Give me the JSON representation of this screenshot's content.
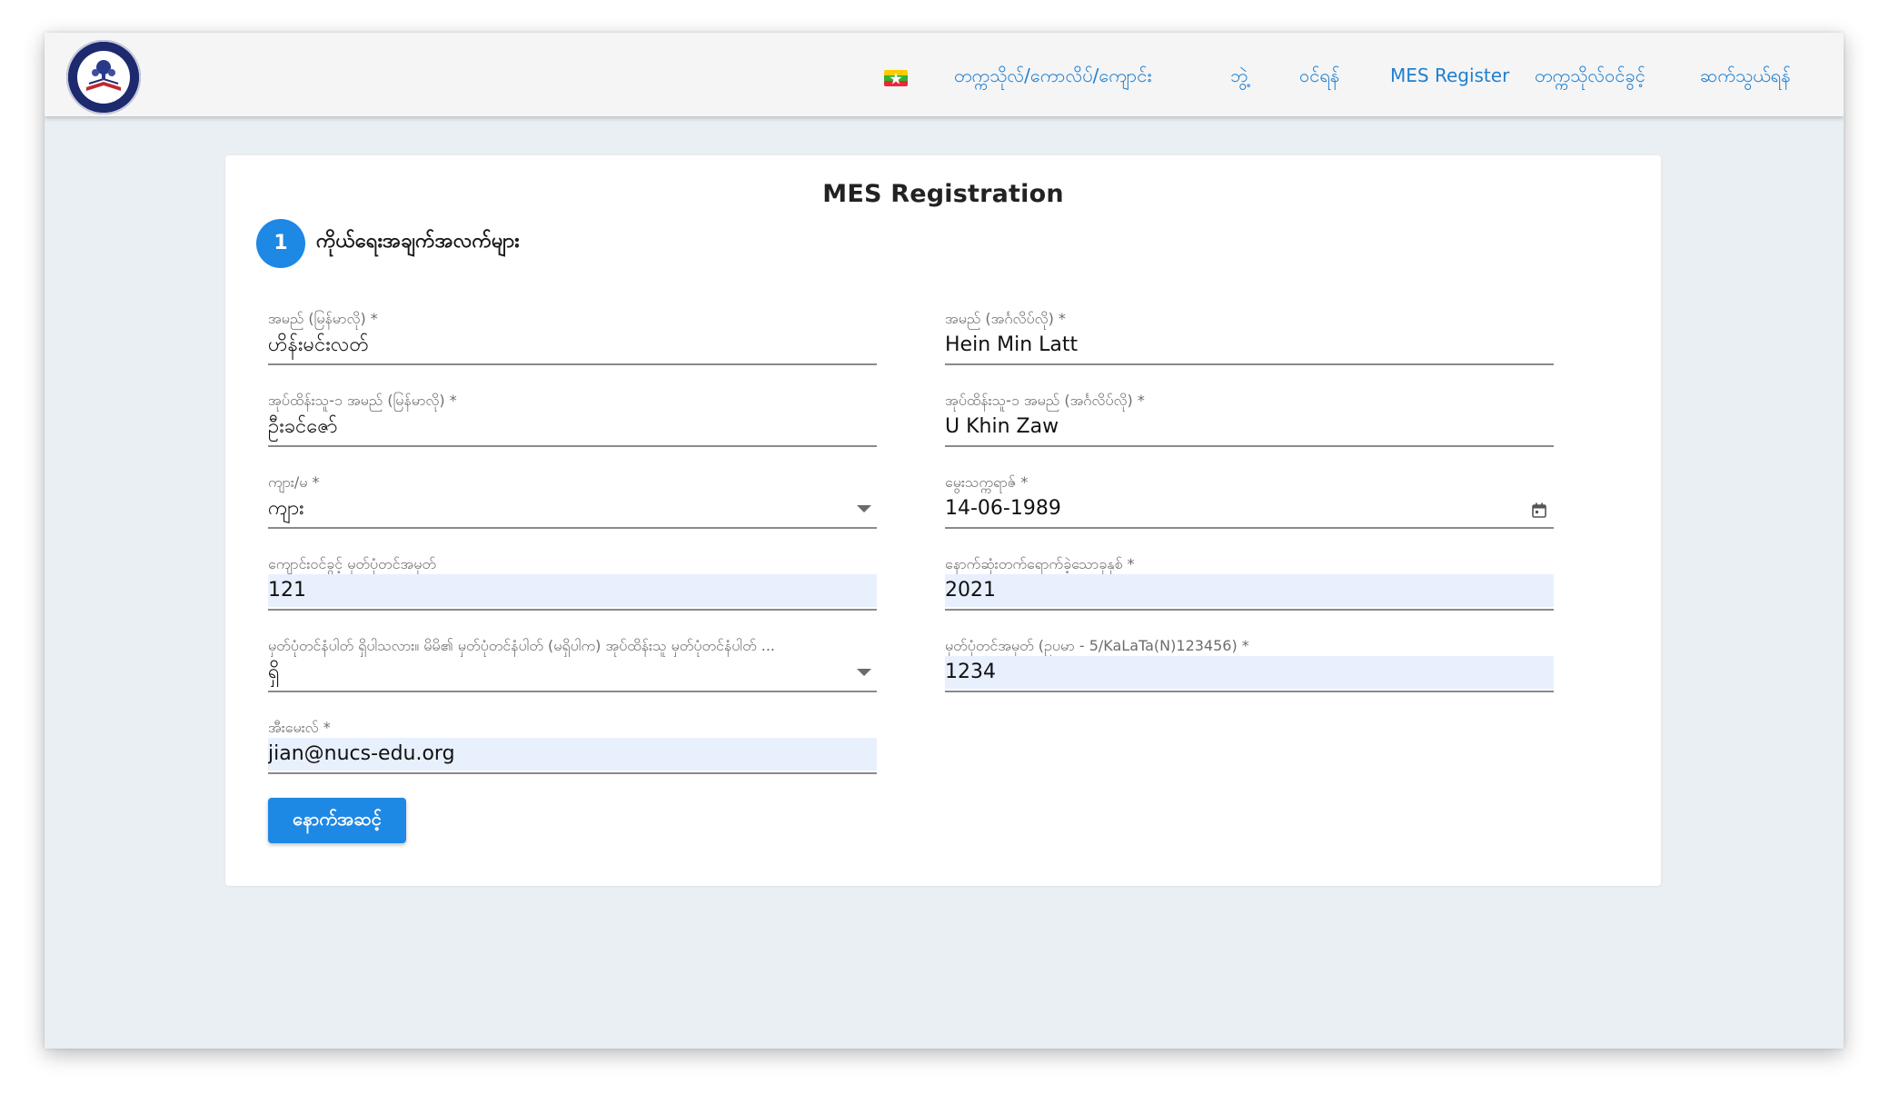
{
  "nav": {
    "links": [
      "တက္ကသိုလ်/ကောလိပ်/ကျောင်း",
      "ဘွဲ့",
      "ဝင်ရန်",
      "MES Register",
      "တက္ကသိုလ်ဝင်ခွင့်",
      "ဆက်သွယ်ရန်"
    ]
  },
  "form": {
    "title": "MES Registration",
    "step_number": "1",
    "step_label": "ကိုယ်ရေးအချက်အလက်များ",
    "fields": {
      "name_mm": {
        "label": "အမည် (မြန်မာလို) *",
        "value": "ဟိန်းမင်းလတ်"
      },
      "name_en": {
        "label": "အမည် (အင်္ဂလိပ်လို) *",
        "value": "Hein Min Latt"
      },
      "father_mm": {
        "label": "အုပ်ထိန်းသူ-၁ အမည် (မြန်မာလို) *",
        "value": "ဦးခင်ဇော်"
      },
      "father_en": {
        "label": "အုပ်ထိန်းသူ-၁ အမည် (အင်္ဂလိပ်လို) *",
        "value": "U Khin Zaw"
      },
      "gender": {
        "label": "ကျား/မ *",
        "value": "ကျား"
      },
      "dob": {
        "label": "မွေးသက္ကရာဇ် *",
        "value": "14-06-1989"
      },
      "roll_no": {
        "label": "ကျောင်းဝင်ခွင့် မှတ်ပုံတင်အမှတ်",
        "value": "121"
      },
      "passed_year": {
        "label": "နောက်ဆုံးတက်ရောက်ခဲ့သောခုနှစ် *",
        "value": "2021"
      },
      "nrc_has": {
        "label": "မှတ်ပုံတင်နံပါတ် ရှိပါသလား။ မိမိ၏ မှတ်ပုံတင်နံပါတ် (မရှိပါက) အုပ်ထိန်းသူ မှတ်ပုံတင်နံပါတ် ...",
        "value": "ရှိ"
      },
      "nrc_no": {
        "label": "မှတ်ပုံတင်အမှတ် (ဥပမာ - 5/KaLaTa(N)123456) *",
        "value": "1234"
      },
      "email": {
        "label": "အီးမေးလ် *",
        "value": "jian@nucs-edu.org"
      }
    },
    "next_button": "နောက်အဆင့်"
  },
  "colors": {
    "accent": "#1e88e5",
    "nav_link": "#1e7fd0",
    "page_bg": "#e9eff3",
    "autofill_bg": "#e8f0fe"
  },
  "icons": [
    "university-logo",
    "myanmar-flag-icon",
    "dropdown-caret-icon",
    "calendar-icon"
  ]
}
